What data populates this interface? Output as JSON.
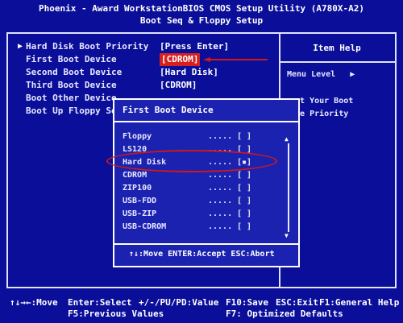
{
  "header": {
    "title_line1": "Phoenix - Award WorkstationBIOS CMOS Setup Utility (A780X-A2)",
    "title_line2": "Boot Seq & Floppy Setup"
  },
  "menu": {
    "items": [
      {
        "label": "Hard Disk Boot Priority",
        "value": "[Press Enter]"
      },
      {
        "label": "First Boot Device",
        "value": "[CDROM]"
      },
      {
        "label": "Second Boot Device",
        "value": "[Hard Disk]"
      },
      {
        "label": "Third Boot Device",
        "value": "[CDROM]"
      },
      {
        "label": "Boot Other Device",
        "value": ""
      },
      {
        "label": "Boot Up Floppy Se",
        "value": ""
      }
    ]
  },
  "help": {
    "title": "Item Help",
    "menu_level": "Menu Level",
    "text_line1": "ect Your Boot",
    "text_line2": "ice Priority"
  },
  "popup": {
    "title": "First Boot Device",
    "options": [
      {
        "label": "Floppy",
        "dots": ".....",
        "box": "[ ]"
      },
      {
        "label": "LS120",
        "dots": ".....",
        "box": "[ ]"
      },
      {
        "label": "Hard Disk",
        "dots": ".....",
        "box": "[▪]"
      },
      {
        "label": "CDROM",
        "dots": ".....",
        "box": "[ ]"
      },
      {
        "label": "ZIP100",
        "dots": ".....",
        "box": "[ ]"
      },
      {
        "label": "USB-FDD",
        "dots": ".....",
        "box": "[ ]"
      },
      {
        "label": "USB-ZIP",
        "dots": ".....",
        "box": "[ ]"
      },
      {
        "label": "USB-CDROM",
        "dots": ".....",
        "box": "[ ]"
      }
    ],
    "footer": "↑↓:Move ENTER:Accept ESC:Abort"
  },
  "footer": {
    "move": "↑↓→←:Move",
    "select": "Enter:Select",
    "value": "+/-/PU/PD:Value",
    "save": "F10:Save",
    "exit": "ESC:Exit",
    "help": "F1:General Help",
    "prev": "F5:Previous Values",
    "defaults": "F7: Optimized Defaults"
  },
  "colors": {
    "background": "#0a0e98",
    "popup_bg": "#1b22b0",
    "highlight": "#d62020",
    "annotation": "#d01818"
  }
}
